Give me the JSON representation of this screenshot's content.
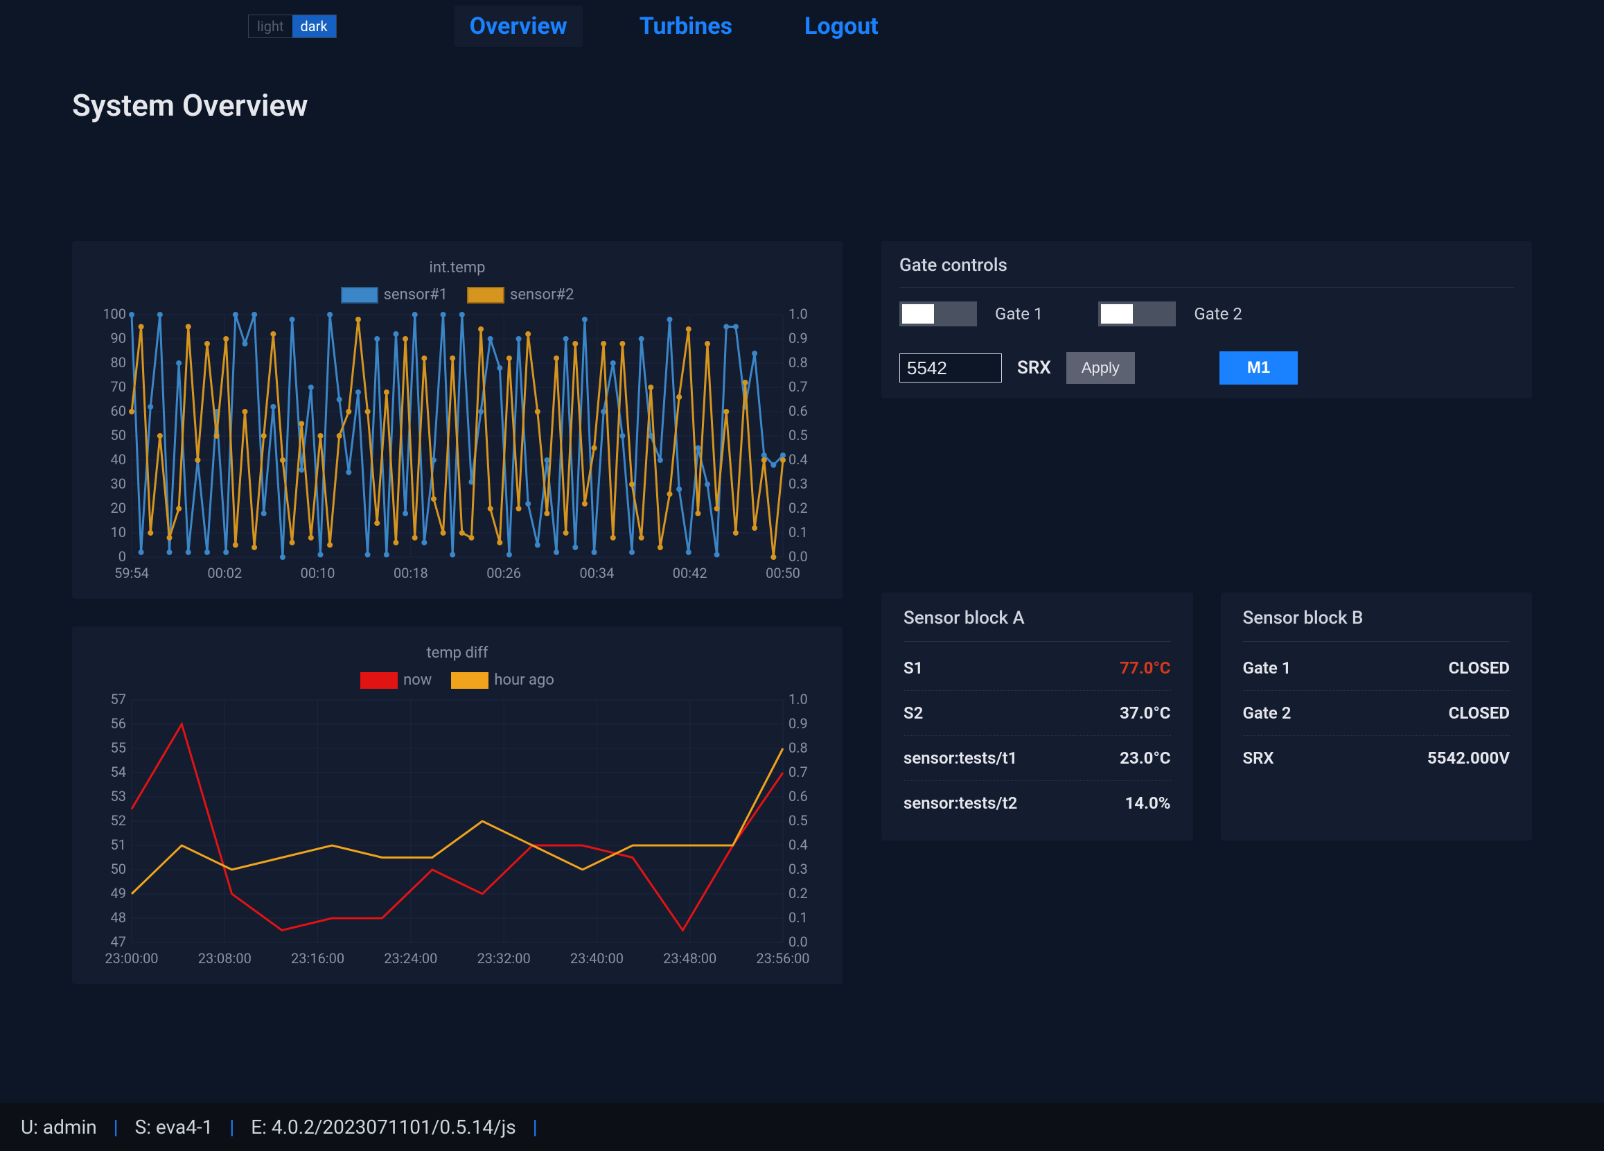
{
  "theme": {
    "light_label": "light",
    "dark_label": "dark"
  },
  "nav": {
    "overview": "Overview",
    "turbines": "Turbines",
    "logout": "Logout"
  },
  "page_title": "System Overview",
  "gate_controls": {
    "title": "Gate controls",
    "gate1_label": "Gate 1",
    "gate2_label": "Gate 2",
    "srx_input_value": "5542",
    "srx_label": "SRX",
    "apply_label": "Apply",
    "m1_label": "M1"
  },
  "sensor_block_a": {
    "title": "Sensor block A",
    "rows": [
      {
        "k": "S1",
        "v": "77.0°C",
        "warn": true
      },
      {
        "k": "S2",
        "v": "37.0°C"
      },
      {
        "k": "sensor:tests/t1",
        "v": "23.0°C"
      },
      {
        "k": "sensor:tests/t2",
        "v": "14.0%"
      }
    ]
  },
  "sensor_block_b": {
    "title": "Sensor block B",
    "rows": [
      {
        "k": "Gate 1",
        "v": "CLOSED"
      },
      {
        "k": "Gate 2",
        "v": "CLOSED"
      },
      {
        "k": "SRX",
        "v": "5542.000V"
      }
    ]
  },
  "footer": {
    "user": "U: admin",
    "server": "S: eva4-1",
    "engine": "E: 4.0.2/2023071101/0.5.14/js"
  },
  "chart_data": [
    {
      "id": "int_temp",
      "type": "line",
      "title": "int.temp",
      "series": [
        {
          "name": "sensor#1",
          "color": "#3b86c7",
          "values": [
            100,
            2,
            62,
            100,
            2,
            80,
            2,
            40,
            2,
            60,
            2,
            100,
            88,
            100,
            18,
            62,
            0,
            98,
            36,
            70,
            1,
            100,
            65,
            35,
            68,
            1,
            90,
            1,
            92,
            18,
            100,
            6,
            40,
            100,
            1,
            100,
            31,
            60,
            90,
            78,
            1,
            90,
            22,
            5,
            40,
            2,
            90,
            4,
            98,
            2,
            60,
            80,
            50,
            2,
            90,
            50,
            40,
            98,
            28,
            2,
            45,
            30,
            1,
            95,
            95,
            62,
            84,
            42,
            38,
            42
          ]
        },
        {
          "name": "sensor#2",
          "color": "#d6951e",
          "values": [
            60,
            95,
            10,
            50,
            8,
            20,
            95,
            40,
            88,
            50,
            90,
            5,
            60,
            4,
            50,
            92,
            40,
            6,
            55,
            8,
            50,
            5,
            50,
            60,
            98,
            60,
            14,
            68,
            6,
            90,
            8,
            82,
            24,
            10,
            82,
            10,
            8,
            94,
            20,
            6,
            82,
            20,
            92,
            60,
            18,
            82,
            10,
            88,
            22,
            45,
            88,
            8,
            88,
            30,
            8,
            70,
            4,
            26,
            66,
            94,
            18,
            88,
            20,
            60,
            10,
            72,
            12,
            40,
            0,
            40
          ]
        }
      ],
      "y1": {
        "min": 0,
        "max": 100,
        "ticks": [
          0,
          10,
          20,
          30,
          40,
          50,
          60,
          70,
          80,
          90,
          100
        ]
      },
      "y2": {
        "min": 0,
        "max": 1.0,
        "ticks": [
          0,
          0.1,
          0.2,
          0.3,
          0.4,
          0.5,
          0.6,
          0.7,
          0.8,
          0.9,
          1.0
        ]
      },
      "x_ticks": [
        "59:54",
        "00:02",
        "00:10",
        "00:18",
        "00:26",
        "00:34",
        "00:42",
        "00:50"
      ]
    },
    {
      "id": "temp_diff",
      "type": "line",
      "title": "temp diff",
      "series": [
        {
          "name": "now",
          "color": "#e11313",
          "values": [
            52.5,
            56,
            49,
            47.5,
            48,
            48,
            50,
            49,
            51,
            51,
            50.5,
            47.5,
            51,
            54
          ]
        },
        {
          "name": "hour ago",
          "color": "#f1a31c",
          "values": [
            49,
            51,
            50,
            50.5,
            51,
            50.5,
            50.5,
            52,
            51,
            50,
            51,
            51,
            51,
            55
          ]
        }
      ],
      "y1": {
        "min": 47,
        "max": 57,
        "ticks": [
          47,
          48,
          49,
          50,
          51,
          52,
          53,
          54,
          55,
          56,
          57
        ]
      },
      "y2": {
        "min": 0,
        "max": 1.0,
        "ticks": [
          0,
          0.1,
          0.2,
          0.3,
          0.4,
          0.5,
          0.6,
          0.7,
          0.8,
          0.9,
          1.0
        ]
      },
      "x_ticks": [
        "23:00:00",
        "23:08:00",
        "23:16:00",
        "23:24:00",
        "23:32:00",
        "23:40:00",
        "23:48:00",
        "23:56:00"
      ]
    }
  ]
}
